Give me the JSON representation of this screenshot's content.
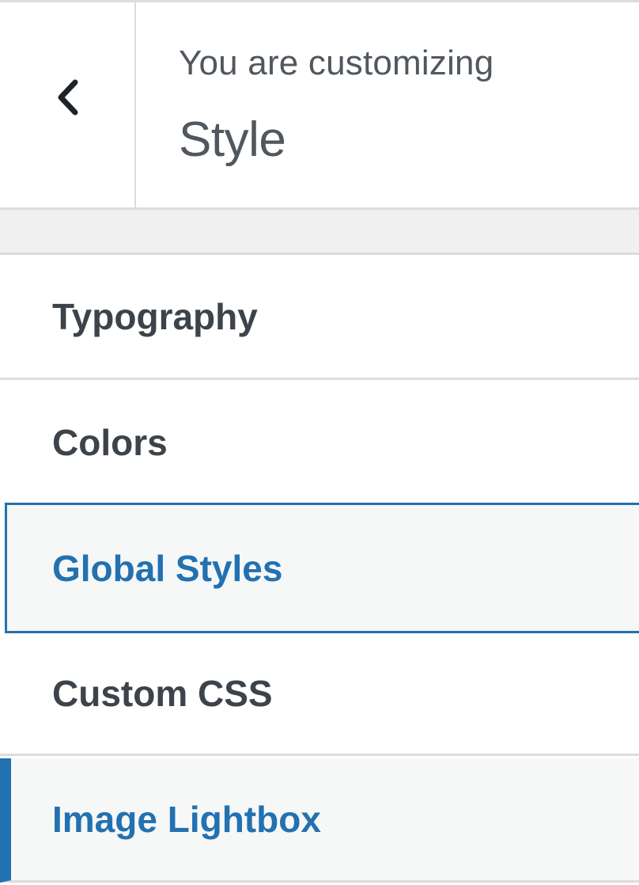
{
  "header": {
    "subtitle": "You are customizing",
    "title": "Style"
  },
  "icons": {
    "back": "chevron-left-icon"
  },
  "menu": {
    "items": [
      {
        "label": "Typography",
        "state": "default"
      },
      {
        "label": "Colors",
        "state": "default"
      },
      {
        "label": "Global Styles",
        "state": "focused"
      },
      {
        "label": "Custom CSS",
        "state": "default"
      },
      {
        "label": "Image Lightbox",
        "state": "active"
      }
    ]
  },
  "colors": {
    "accent": "#2271b1",
    "text": "#3c434a",
    "muted_text": "#50575e",
    "divider": "#dcdcde",
    "hover_bg": "#f6f7f7"
  }
}
